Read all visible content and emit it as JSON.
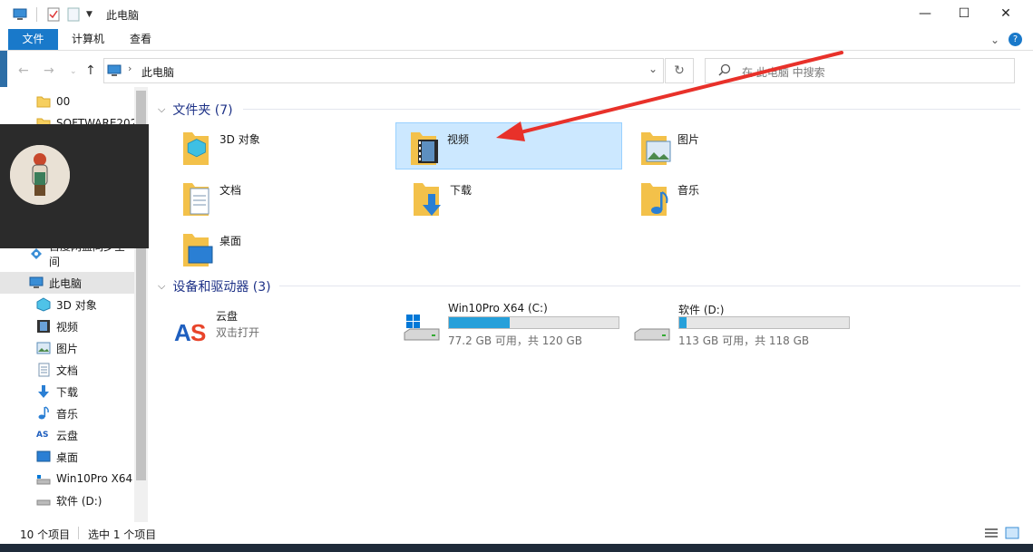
{
  "window": {
    "title": "此电脑",
    "controls": {
      "minimize": "—",
      "maximize": "☐",
      "close": "✕"
    }
  },
  "ribbon": {
    "tabs": [
      "文件",
      "计算机",
      "查看"
    ]
  },
  "nav": {
    "address": "此电脑",
    "search_placeholder": "在 此电脑 中搜索"
  },
  "sidebar": {
    "items": [
      {
        "label": "00",
        "icon": "folder-icon"
      },
      {
        "label": "SOFTWARE202",
        "icon": "folder-icon"
      },
      {
        "label": "百度网盘同步空间",
        "icon": "baidu-sync-icon"
      },
      {
        "label": "此电脑",
        "icon": "pc-icon",
        "selected": true
      },
      {
        "label": "3D 对象",
        "icon": "3d-objects-icon"
      },
      {
        "label": "视频",
        "icon": "video-icon"
      },
      {
        "label": "图片",
        "icon": "pictures-icon"
      },
      {
        "label": "文档",
        "icon": "documents-icon"
      },
      {
        "label": "下载",
        "icon": "download-icon"
      },
      {
        "label": "音乐",
        "icon": "music-icon"
      },
      {
        "label": "云盘",
        "icon": "cloud-disk-icon"
      },
      {
        "label": "桌面",
        "icon": "desktop-icon"
      },
      {
        "label": "Win10Pro X64",
        "icon": "drive-icon"
      },
      {
        "label": "软件 (D:)",
        "icon": "drive-icon"
      }
    ]
  },
  "main": {
    "folders_header": "文件夹 (7)",
    "folders": [
      {
        "label": "3D 对象",
        "icon": "3d-objects-folder-icon"
      },
      {
        "label": "视频",
        "icon": "video-folder-icon",
        "selected": true
      },
      {
        "label": "图片",
        "icon": "pictures-folder-icon"
      },
      {
        "label": "文档",
        "icon": "documents-folder-icon"
      },
      {
        "label": "下载",
        "icon": "downloads-folder-icon"
      },
      {
        "label": "音乐",
        "icon": "music-folder-icon"
      },
      {
        "label": "桌面",
        "icon": "desktop-folder-icon"
      }
    ],
    "devices_header": "设备和驱动器 (3)",
    "cloud": {
      "name": "云盘",
      "sub": "双击打开"
    },
    "drives": [
      {
        "name": "Win10Pro X64 (C:)",
        "free": "77.2 GB 可用，共 120 GB",
        "used_fraction": 0.357
      },
      {
        "name": "软件 (D:)",
        "free": "113 GB 可用，共 118 GB",
        "used_fraction": 0.042
      }
    ]
  },
  "status": {
    "count": "10 个项目",
    "selected": "选中 1 个项目"
  },
  "colors": {
    "accent": "#1979ca",
    "selection": "#cce8ff",
    "drive_bar": "#26a0da",
    "annotation_arrow": "#e8312a"
  }
}
